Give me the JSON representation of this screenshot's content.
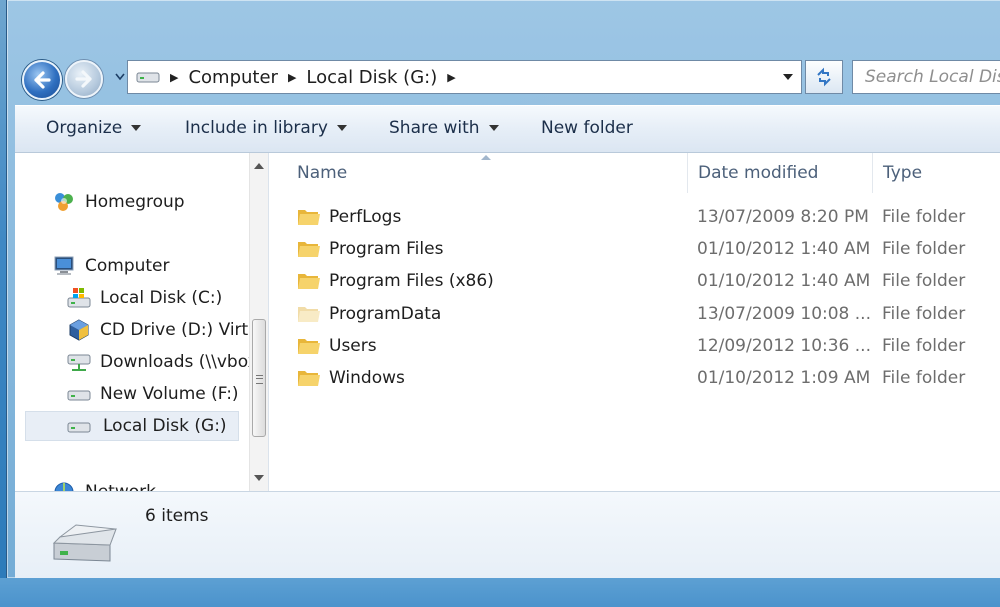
{
  "navigation": {
    "back_icon": "back-arrow-icon",
    "forward_icon": "forward-arrow-icon"
  },
  "address_bar": {
    "drive_icon": "drive-icon",
    "breadcrumbs": [
      "Computer",
      "Local Disk (G:)"
    ]
  },
  "search": {
    "placeholder": "Search Local Disk (G:)"
  },
  "toolbar": {
    "organize": "Organize",
    "include_in_library": "Include in library",
    "share_with": "Share with",
    "new_folder": "New folder"
  },
  "nav_pane": {
    "homegroup": "Homegroup",
    "computer": "Computer",
    "drives": [
      "Local Disk (C:)",
      "CD Drive (D:) VirtualBox Guest Additions",
      "Downloads (\\\\vboxsrv)",
      "New Volume (F:)",
      "Local Disk (G:)"
    ],
    "network": "Network",
    "selected": "Local Disk (G:)"
  },
  "columns": {
    "name": "Name",
    "date_modified": "Date modified",
    "type": "Type"
  },
  "files": [
    {
      "name": "PerfLogs",
      "date": "13/07/2009 8:20 PM",
      "type": "File folder"
    },
    {
      "name": "Program Files",
      "date": "01/10/2012 1:40 AM",
      "type": "File folder"
    },
    {
      "name": "Program Files (x86)",
      "date": "01/10/2012 1:40 AM",
      "type": "File folder"
    },
    {
      "name": "ProgramData",
      "date": "13/07/2009 10:08 ...",
      "type": "File folder"
    },
    {
      "name": "Users",
      "date": "12/09/2012 10:36 ...",
      "type": "File folder"
    },
    {
      "name": "Windows",
      "date": "01/10/2012 1:09 AM",
      "type": "File folder"
    }
  ],
  "details_pane": {
    "item_count": "6 items"
  },
  "colors": {
    "window_frame": "#78afd7",
    "selection": "#e8eef6",
    "folder": "#f2c94c"
  }
}
